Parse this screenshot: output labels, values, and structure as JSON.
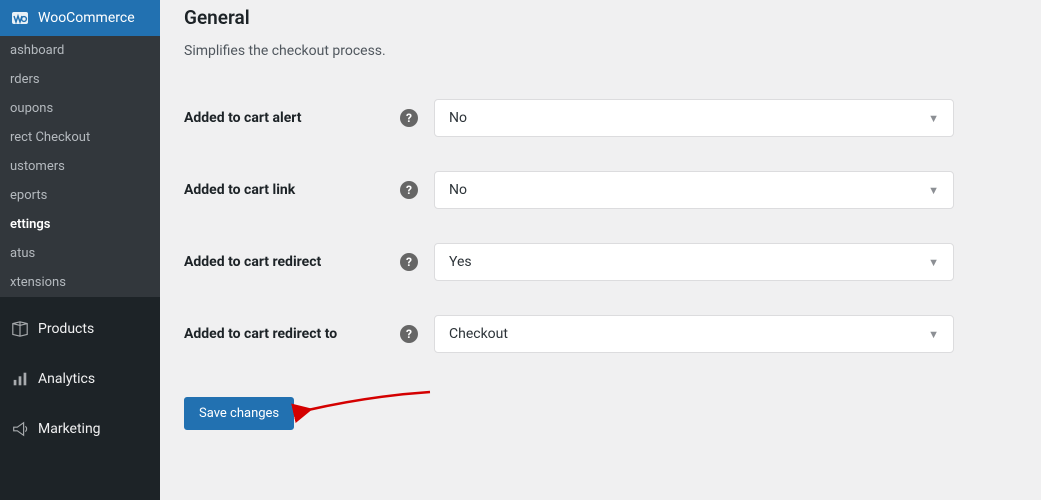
{
  "sidebar": {
    "woocommerce_label": "WooCommerce",
    "subitems": [
      {
        "label": "ashboard"
      },
      {
        "label": "rders"
      },
      {
        "label": "oupons"
      },
      {
        "label": "rect Checkout"
      },
      {
        "label": "ustomers"
      },
      {
        "label": "eports"
      },
      {
        "label": "ettings"
      },
      {
        "label": "atus"
      },
      {
        "label": "xtensions"
      }
    ],
    "products_label": "Products",
    "analytics_label": "Analytics",
    "marketing_label": "Marketing"
  },
  "content": {
    "section_title": "General",
    "section_desc": "Simplifies the checkout process.",
    "rows": [
      {
        "label": "Added to cart alert",
        "value": "No"
      },
      {
        "label": "Added to cart link",
        "value": "No"
      },
      {
        "label": "Added to cart redirect",
        "value": "Yes"
      },
      {
        "label": "Added to cart redirect to",
        "value": "Checkout"
      }
    ],
    "save_button": "Save changes"
  }
}
